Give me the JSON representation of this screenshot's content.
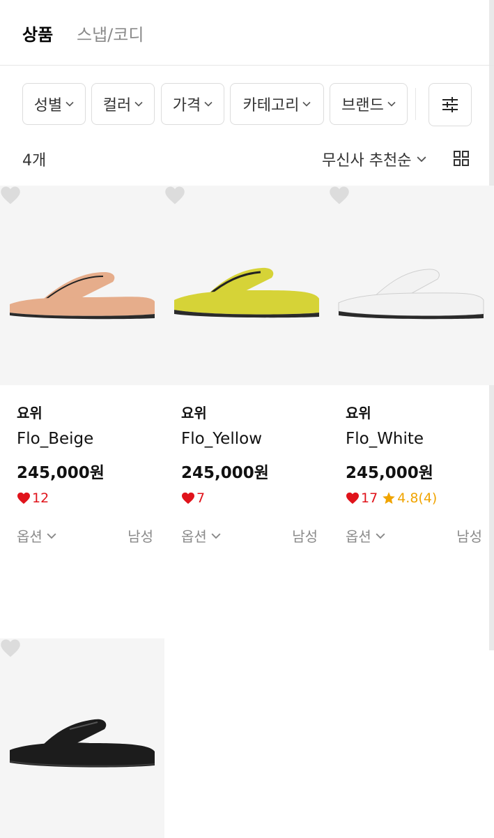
{
  "tabs": {
    "products": "상품",
    "snap": "스냅/코디"
  },
  "filters": [
    {
      "label": "성별"
    },
    {
      "label": "컬러"
    },
    {
      "label": "가격"
    },
    {
      "label": "카테고리"
    },
    {
      "label": "브랜드"
    }
  ],
  "results": {
    "count": "4개",
    "sort": "무신사 추천순"
  },
  "products": [
    {
      "brand": "요위",
      "name": "Flo_Beige",
      "price": "245,000원",
      "likes": "12",
      "rating": "",
      "option": "옵션",
      "gender": "남성",
      "color": "#e6ad8b"
    },
    {
      "brand": "요위",
      "name": "Flo_Yellow",
      "price": "245,000원",
      "likes": "7",
      "rating": "",
      "option": "옵션",
      "gender": "남성",
      "color": "#d6d337"
    },
    {
      "brand": "요위",
      "name": "Flo_White",
      "price": "245,000원",
      "likes": "17",
      "rating": "4.8(4)",
      "option": "옵션",
      "gender": "남성",
      "color": "#f2f2f2"
    },
    {
      "brand": "",
      "name": "",
      "price": "",
      "likes": "",
      "rating": "",
      "option": "",
      "gender": "",
      "color": "#1c1c1c"
    }
  ]
}
